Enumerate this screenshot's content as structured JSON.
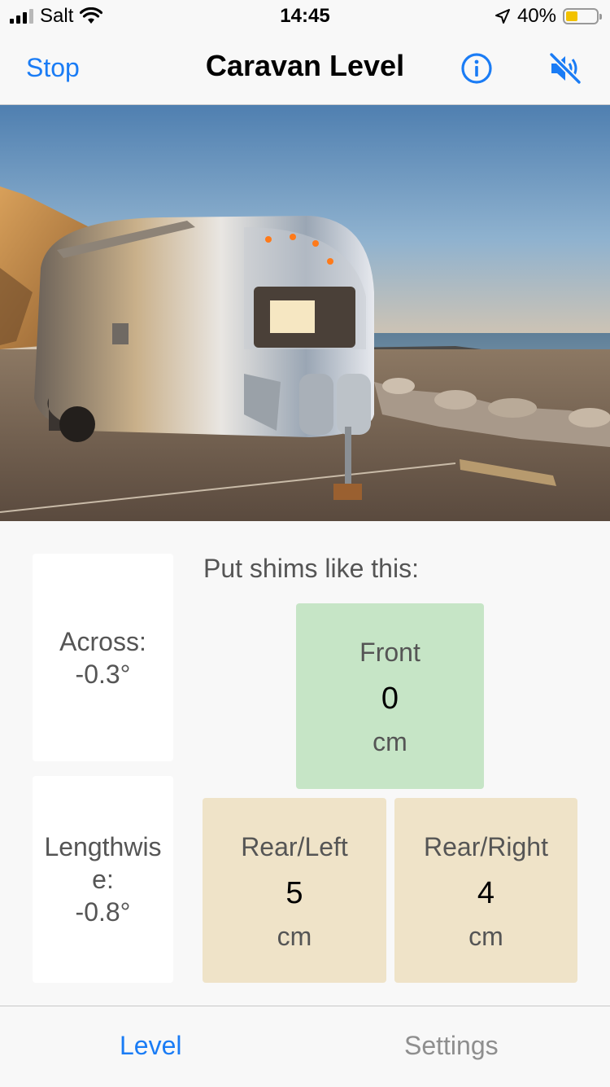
{
  "status_bar": {
    "carrier": "Salt",
    "time": "14:45",
    "battery_percent": "40%",
    "battery_level": 0.4,
    "icons": [
      "signal-icon",
      "wifi-icon",
      "location-arrow-icon",
      "battery-icon"
    ]
  },
  "nav": {
    "stop_label": "Stop",
    "title": "Caravan Level",
    "info_icon": "info-icon",
    "mute_icon": "speaker-muted-icon",
    "accent_color": "#1a7cf5"
  },
  "hero": {
    "image": "airstream-caravan-beach-photo"
  },
  "angles": {
    "across_label": "Across:",
    "across_value": "-0.3°",
    "lengthwise_label": "Lengthwise:",
    "lengthwise_value": "-0.8°"
  },
  "shims": {
    "prompt": "Put shims like this:",
    "front": {
      "label": "Front",
      "value": "0",
      "unit": "cm",
      "color": "#c6e5c6"
    },
    "rear_left": {
      "label": "Rear/Left",
      "value": "5",
      "unit": "cm",
      "color": "#efe3c8"
    },
    "rear_right": {
      "label": "Rear/Right",
      "value": "4",
      "unit": "cm",
      "color": "#efe3c8"
    }
  },
  "tabs": {
    "level": "Level",
    "settings": "Settings",
    "active": "Level"
  }
}
